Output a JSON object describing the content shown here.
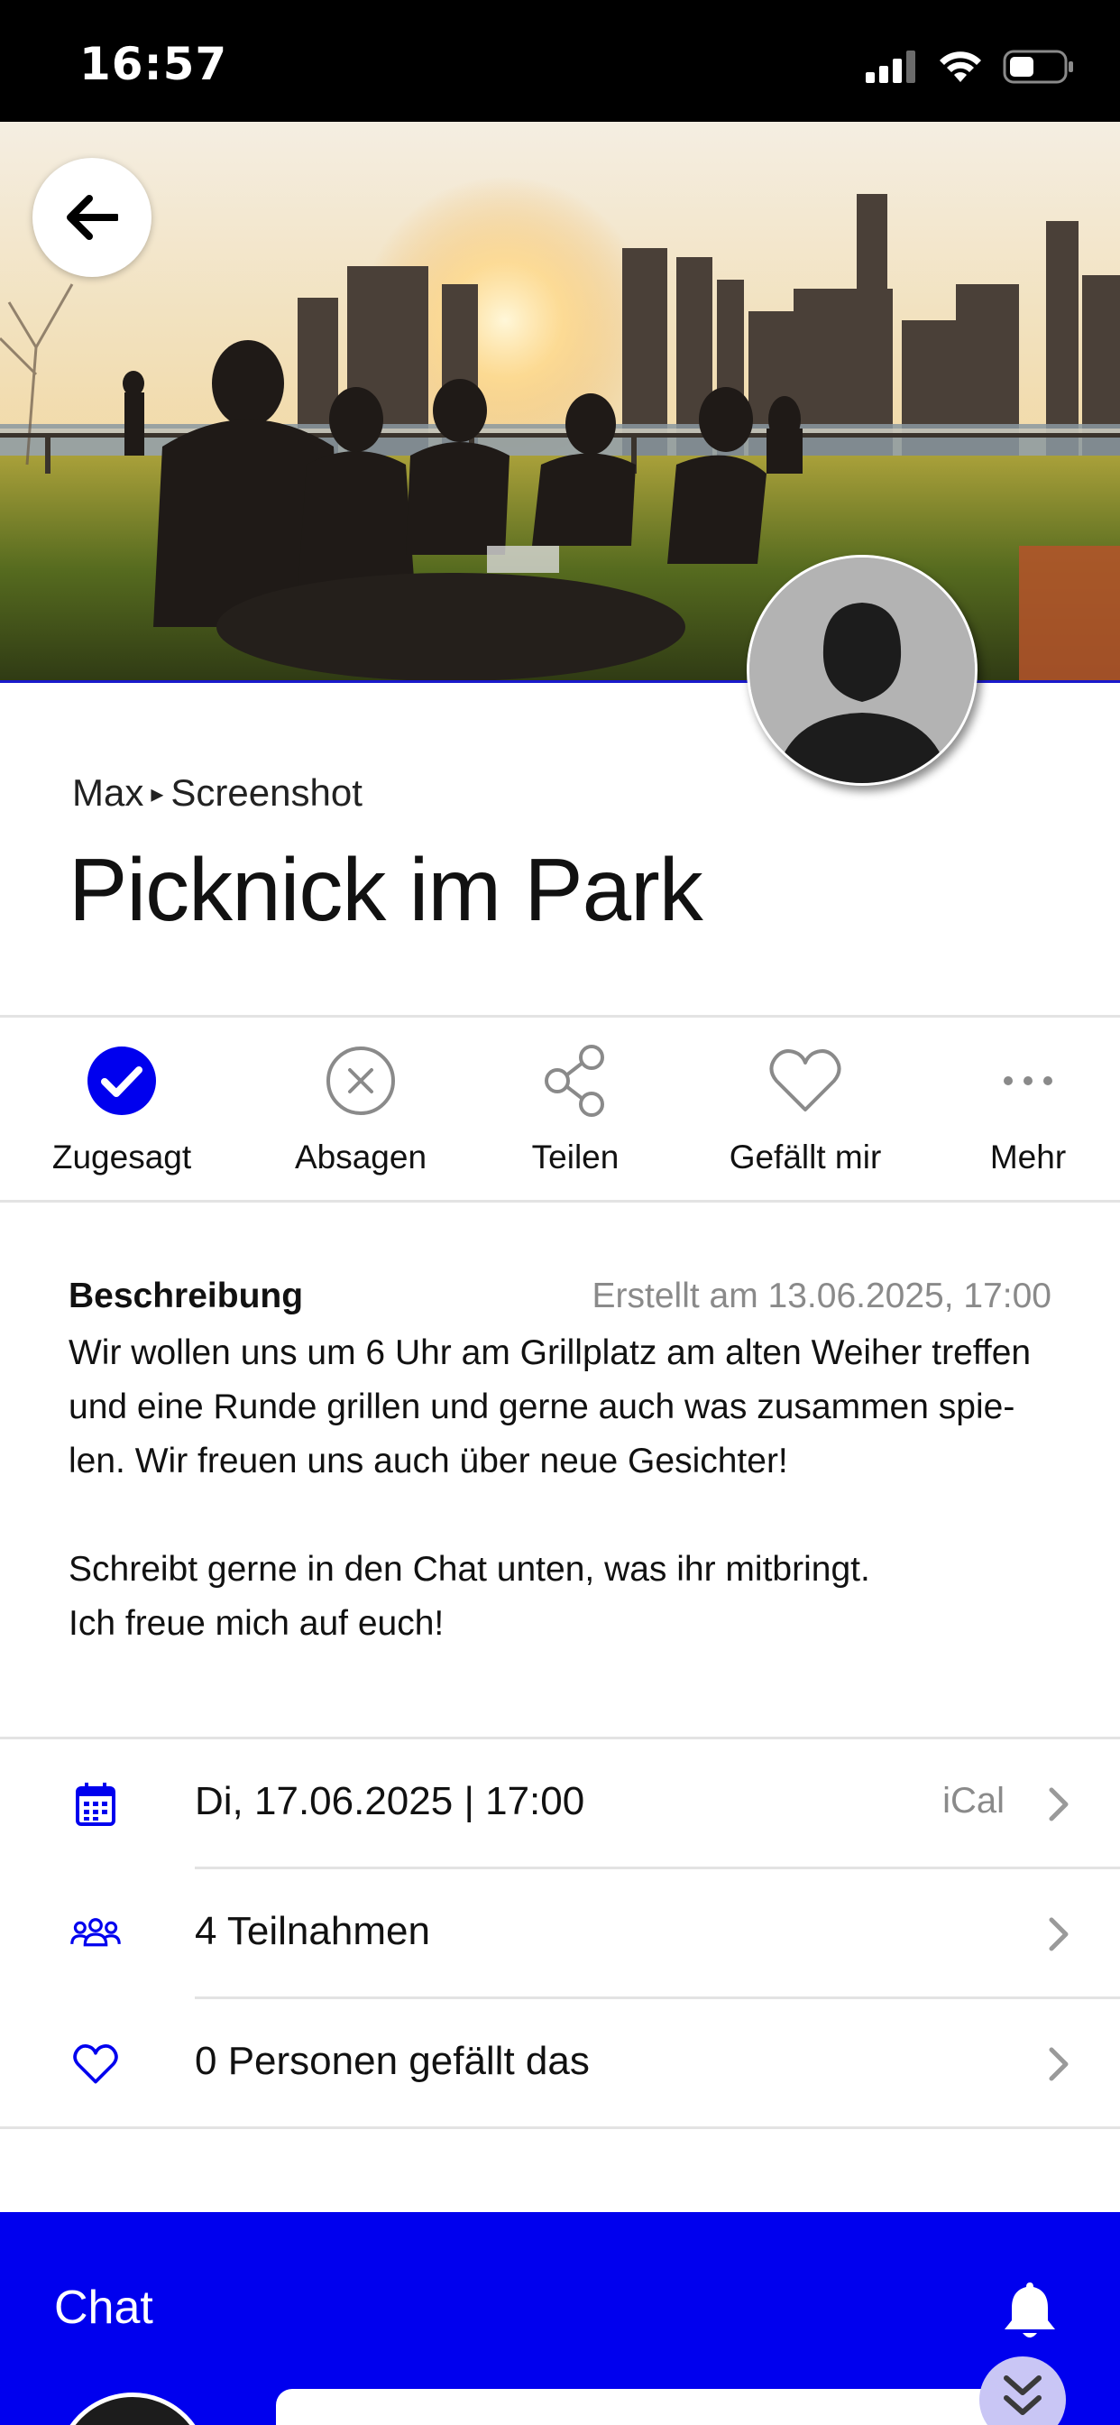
{
  "status_bar": {
    "time": "16:57"
  },
  "event": {
    "breadcrumb": {
      "user": "Max",
      "separator": "▸",
      "group": "Screenshot"
    },
    "title": "Picknick im Park"
  },
  "actions": [
    {
      "label": "Zugesagt",
      "icon": "check-circle-icon"
    },
    {
      "label": "Absagen",
      "icon": "x-circle-icon"
    },
    {
      "label": "Teilen",
      "icon": "share-icon"
    },
    {
      "label": "Gefällt mir",
      "icon": "heart-icon"
    },
    {
      "label": "Mehr",
      "icon": "more-icon"
    }
  ],
  "description": {
    "heading": "Beschreibung",
    "created": "Erstellt am 13.06.2025, 17:00",
    "lines": [
      "Wir wollen uns um 6 Uhr am Grillplatz am alten Weiher treffen",
      "und eine Runde grillen und gerne auch was zusammen spie-",
      "len. Wir freuen uns auch über neue Gesichter!",
      "",
      "Schreibt gerne in den Chat unten, was ihr mitbringt.",
      "Ich freue mich auf euch!"
    ]
  },
  "info": {
    "date": {
      "text": "Di, 17.06.2025 | 17:00",
      "extra": "iCal",
      "icon": "calendar-icon"
    },
    "participants": {
      "text": "4 Teilnahmen",
      "icon": "people-icon"
    },
    "likes": {
      "text": "0 Personen gefällt das",
      "icon": "heart-outline-icon"
    }
  },
  "chat": {
    "title": "Chat"
  },
  "colors": {
    "accent": "#0000EE",
    "divider": "#E3E3E3",
    "muted": "#8A8A8A"
  }
}
